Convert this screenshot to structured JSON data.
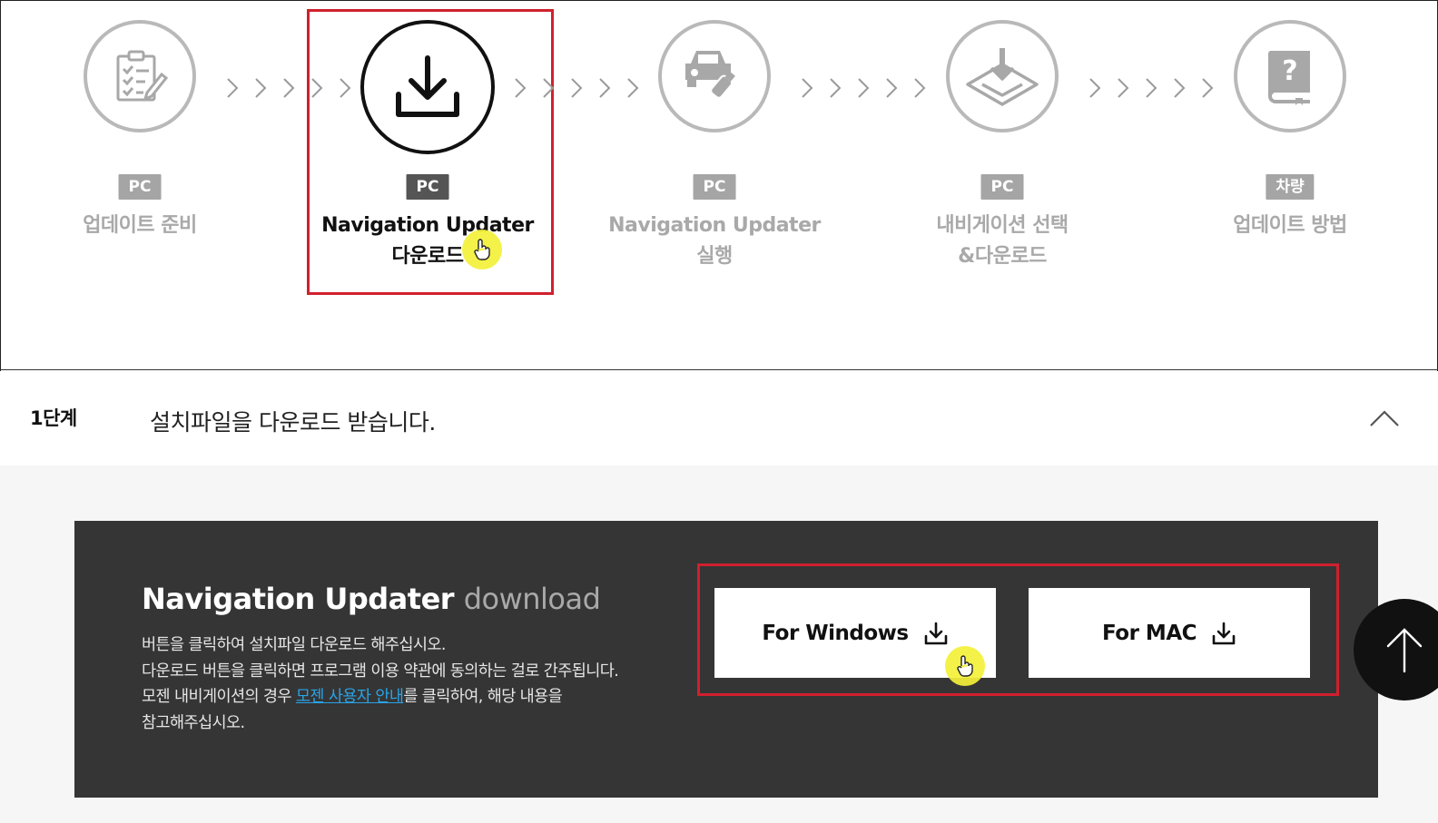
{
  "steps": [
    {
      "badge": "PC",
      "line1": "업데이트 준비",
      "line2": "",
      "icon": "clipboard-checklist-icon"
    },
    {
      "badge": "PC",
      "line1": "Navigation Updater",
      "line2": "다운로드",
      "icon": "download-icon",
      "active": true
    },
    {
      "badge": "PC",
      "line1": "Navigation Updater",
      "line2": "실행",
      "icon": "car-usb-icon"
    },
    {
      "badge": "PC",
      "line1": "내비게이션 선택",
      "line2": "&다운로드",
      "icon": "map-download-icon"
    },
    {
      "badge": "차량",
      "line1": "업데이트 방법",
      "line2": "",
      "icon": "help-book-icon"
    }
  ],
  "accordion": {
    "step_label": "1단계",
    "title": "설치파일을 다운로드 받습니다."
  },
  "panel": {
    "title_bold": "Navigation Updater",
    "title_light": "download",
    "desc_line1": "버튼을 클릭하여 설치파일 다운로드 해주십시오.",
    "desc_line2": "다운로드 버튼을 클릭하면 프로그램 이용 약관에 동의하는 걸로 간주됩니다.",
    "desc_line3_pre": "모젠 내비게이션의 경우 ",
    "desc_link": "모젠 사용자 안내",
    "desc_line3_post": "를 클릭하여, 해당 내용을",
    "desc_line4": "참고해주십시오.",
    "windows_label": "For Windows",
    "mac_label": "For MAC"
  },
  "colors": {
    "highlight": "#d0202e",
    "panel_bg": "#353535",
    "inactive": "#b9b9b9",
    "link": "#2aa3e6"
  }
}
